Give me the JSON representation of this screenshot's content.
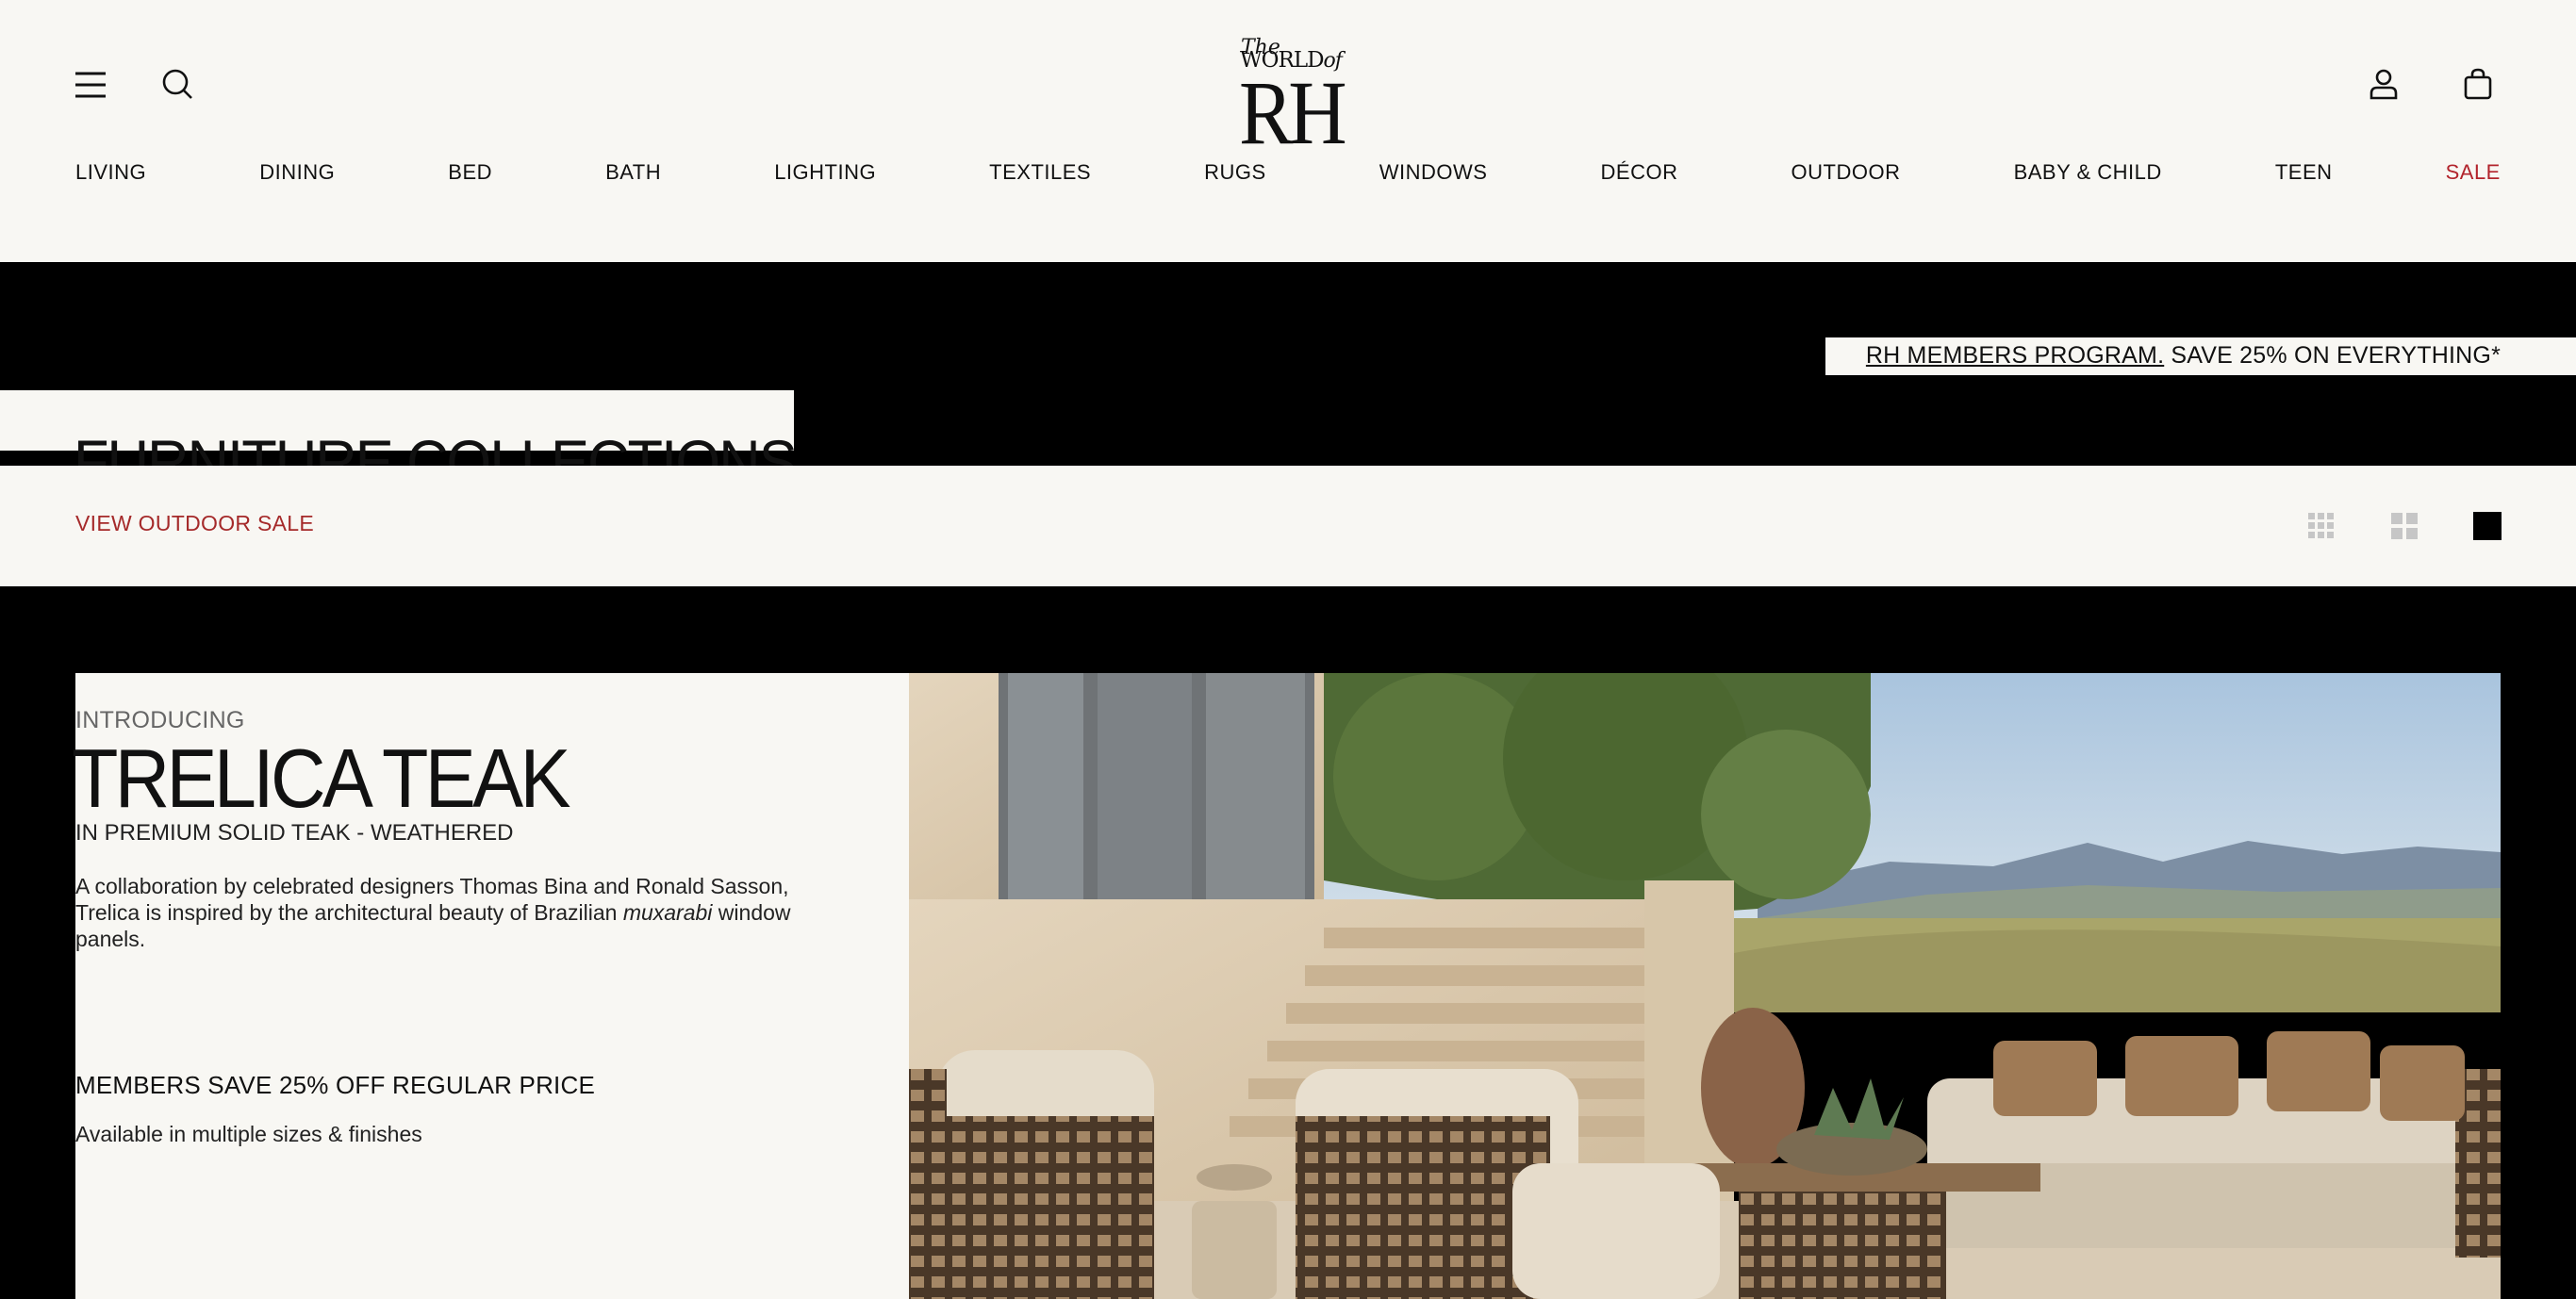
{
  "header": {
    "logo": {
      "the": "The",
      "world": "WORLD",
      "of": "of",
      "brand": "RH"
    },
    "icons": [
      "menu-icon",
      "search-icon",
      "account-icon",
      "shopping-bag-icon"
    ]
  },
  "nav": {
    "items": [
      "LIVING",
      "DINING",
      "BED",
      "BATH",
      "LIGHTING",
      "TEXTILES",
      "RUGS",
      "WINDOWS",
      "DÉCOR",
      "OUTDOOR",
      "BABY & CHILD",
      "TEEN"
    ],
    "sale": "SALE"
  },
  "promo": {
    "link": "RH MEMBERS PROGRAM.",
    "text": "SAVE 25% ON EVERYTHING*"
  },
  "page_title": "FURNITURE COLLECTIONS",
  "toolbar": {
    "sale_link": "VIEW OUTDOOR SALE",
    "grid_options": [
      "grid-3-icon",
      "grid-2-icon",
      "grid-1-icon"
    ]
  },
  "feature": {
    "intro": "INTRODUCING",
    "headline": "TRELICA TEAK",
    "material": "IN PREMIUM SOLID TEAK - WEATHERED",
    "desc_before": "A collaboration by celebrated designers Thomas Bina and Ronald Sasson, Trelica is inspired by the architectural beauty of Brazilian ",
    "desc_em": "muxarabi",
    "desc_after": " window panels.",
    "members": "MEMBERS SAVE 25% OFF REGULAR PRICE",
    "availability": "Available in multiple sizes & finishes"
  },
  "colors": {
    "background": "#f8f7f3",
    "black": "#000000",
    "sale_red": "#b2242c"
  }
}
